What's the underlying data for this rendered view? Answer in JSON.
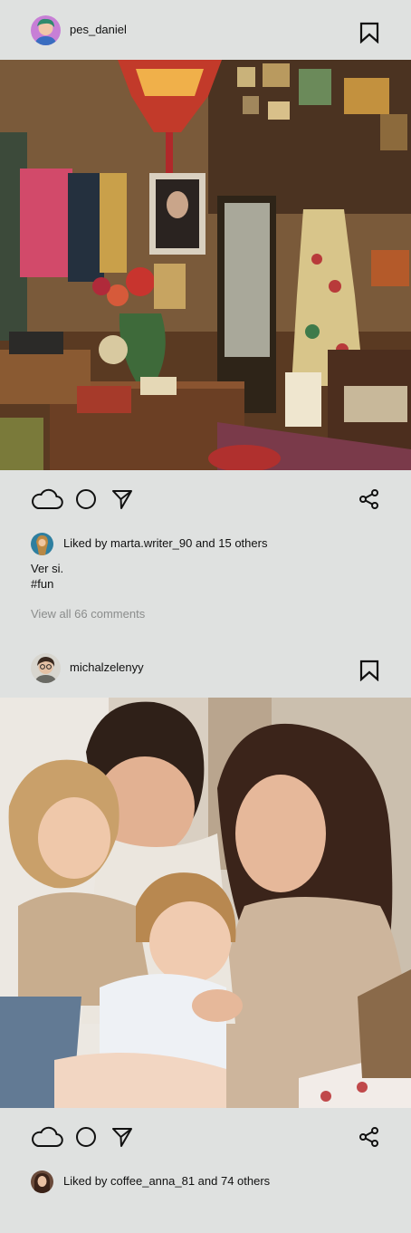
{
  "posts": [
    {
      "username": "pes_daniel",
      "liked_by_text": "Liked by marta.writer_90 and 15 others",
      "caption_line1": "Ver si.",
      "caption_line2": "#fun",
      "view_comments": "View all 66 comments"
    },
    {
      "username": "michalzelenyy",
      "liked_by_text": "Liked by coffee_anna_81 and 74 others"
    }
  ],
  "icons": {
    "like": "cloud-like-icon",
    "comment": "circle-comment-icon",
    "send": "paper-plane-icon",
    "share": "share-icon",
    "save": "bookmark-icon"
  }
}
